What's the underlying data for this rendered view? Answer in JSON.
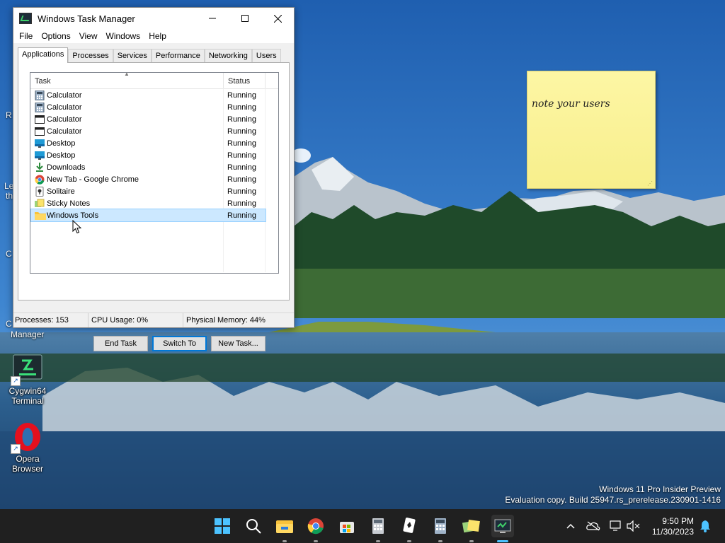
{
  "window": {
    "title": "Windows Task Manager",
    "menu": [
      "File",
      "Options",
      "View",
      "Windows",
      "Help"
    ],
    "tabs": [
      "Applications",
      "Processes",
      "Services",
      "Performance",
      "Networking",
      "Users"
    ],
    "active_tab": "Applications",
    "columns": {
      "task": "Task",
      "status": "Status"
    },
    "rows": [
      {
        "name": "Calculator",
        "status": "Running",
        "icon": "calculator-icon"
      },
      {
        "name": "Calculator",
        "status": "Running",
        "icon": "calculator-icon"
      },
      {
        "name": "Calculator",
        "status": "Running",
        "icon": "window-icon"
      },
      {
        "name": "Calculator",
        "status": "Running",
        "icon": "window-icon"
      },
      {
        "name": "Desktop",
        "status": "Running",
        "icon": "desktop-icon"
      },
      {
        "name": "Desktop",
        "status": "Running",
        "icon": "desktop-icon"
      },
      {
        "name": "Downloads",
        "status": "Running",
        "icon": "download-icon"
      },
      {
        "name": "New Tab - Google Chrome",
        "status": "Running",
        "icon": "chrome-icon"
      },
      {
        "name": "Solitaire",
        "status": "Running",
        "icon": "cards-icon"
      },
      {
        "name": "Sticky Notes",
        "status": "Running",
        "icon": "sticky-notes-icon"
      },
      {
        "name": "Windows Tools",
        "status": "Running",
        "icon": "folder-icon"
      }
    ],
    "selected_row": "Windows Tools",
    "buttons": {
      "end_task": "End Task",
      "switch_to": "Switch To",
      "new_task": "New Task..."
    },
    "statusbar": {
      "processes": "Processes: 153",
      "cpu": "CPU Usage: 0%",
      "memory": "Physical Memory: 44%"
    }
  },
  "desktop": {
    "icons": [
      {
        "label_line1": "Cygwin64",
        "label_line2": "Terminal",
        "icon": "terminal-icon"
      },
      {
        "label_line1": "Opera",
        "label_line2": "Browser",
        "icon": "opera-icon"
      }
    ],
    "partial_label": "Manager",
    "edge_fragments": [
      "R",
      "Le",
      "th",
      "C",
      "C"
    ],
    "sticky_note_text": "note your users",
    "watermark_line1": "Windows 11 Pro Insider Preview",
    "watermark_line2": "Evaluation copy. Build 25947.rs_prerelease.230901-1416"
  },
  "taskbar": {
    "apps": [
      "start-icon",
      "search-icon",
      "file-explorer-icon",
      "chrome-icon",
      "store-icon",
      "calculator-icon",
      "solitaire-icon",
      "calculator-icon",
      "sticky-notes-icon",
      "task-manager-icon"
    ],
    "time": "9:50 PM",
    "date": "11/30/2023"
  },
  "colors": {
    "taskbar": "#202020",
    "selection": "#cce8ff",
    "accent": "#0078d7",
    "sticky": "#fdf6a4"
  }
}
